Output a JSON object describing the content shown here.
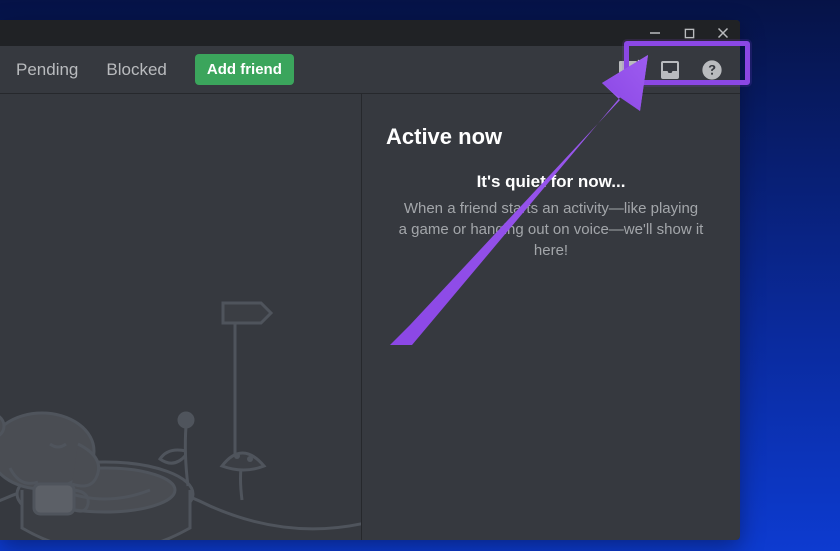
{
  "window": {
    "minimize_icon": "minimize-icon",
    "maximize_icon": "maximize-icon",
    "close_icon": "close-icon"
  },
  "toolbar": {
    "tabs": {
      "pending": "Pending",
      "blocked": "Blocked"
    },
    "add_friend": "Add friend",
    "icons": {
      "new_dm": "new-group-dm-icon",
      "inbox": "inbox-icon",
      "help": "help-icon"
    }
  },
  "active_now": {
    "heading": "Active now",
    "quiet_title": "It's quiet for now...",
    "quiet_body": "When a friend starts an activity—like playing a game or hanging out on voice—we'll show it here!"
  },
  "annotation": {
    "highlight_target": "window-controls",
    "arrow_color": "#8b47e5"
  }
}
